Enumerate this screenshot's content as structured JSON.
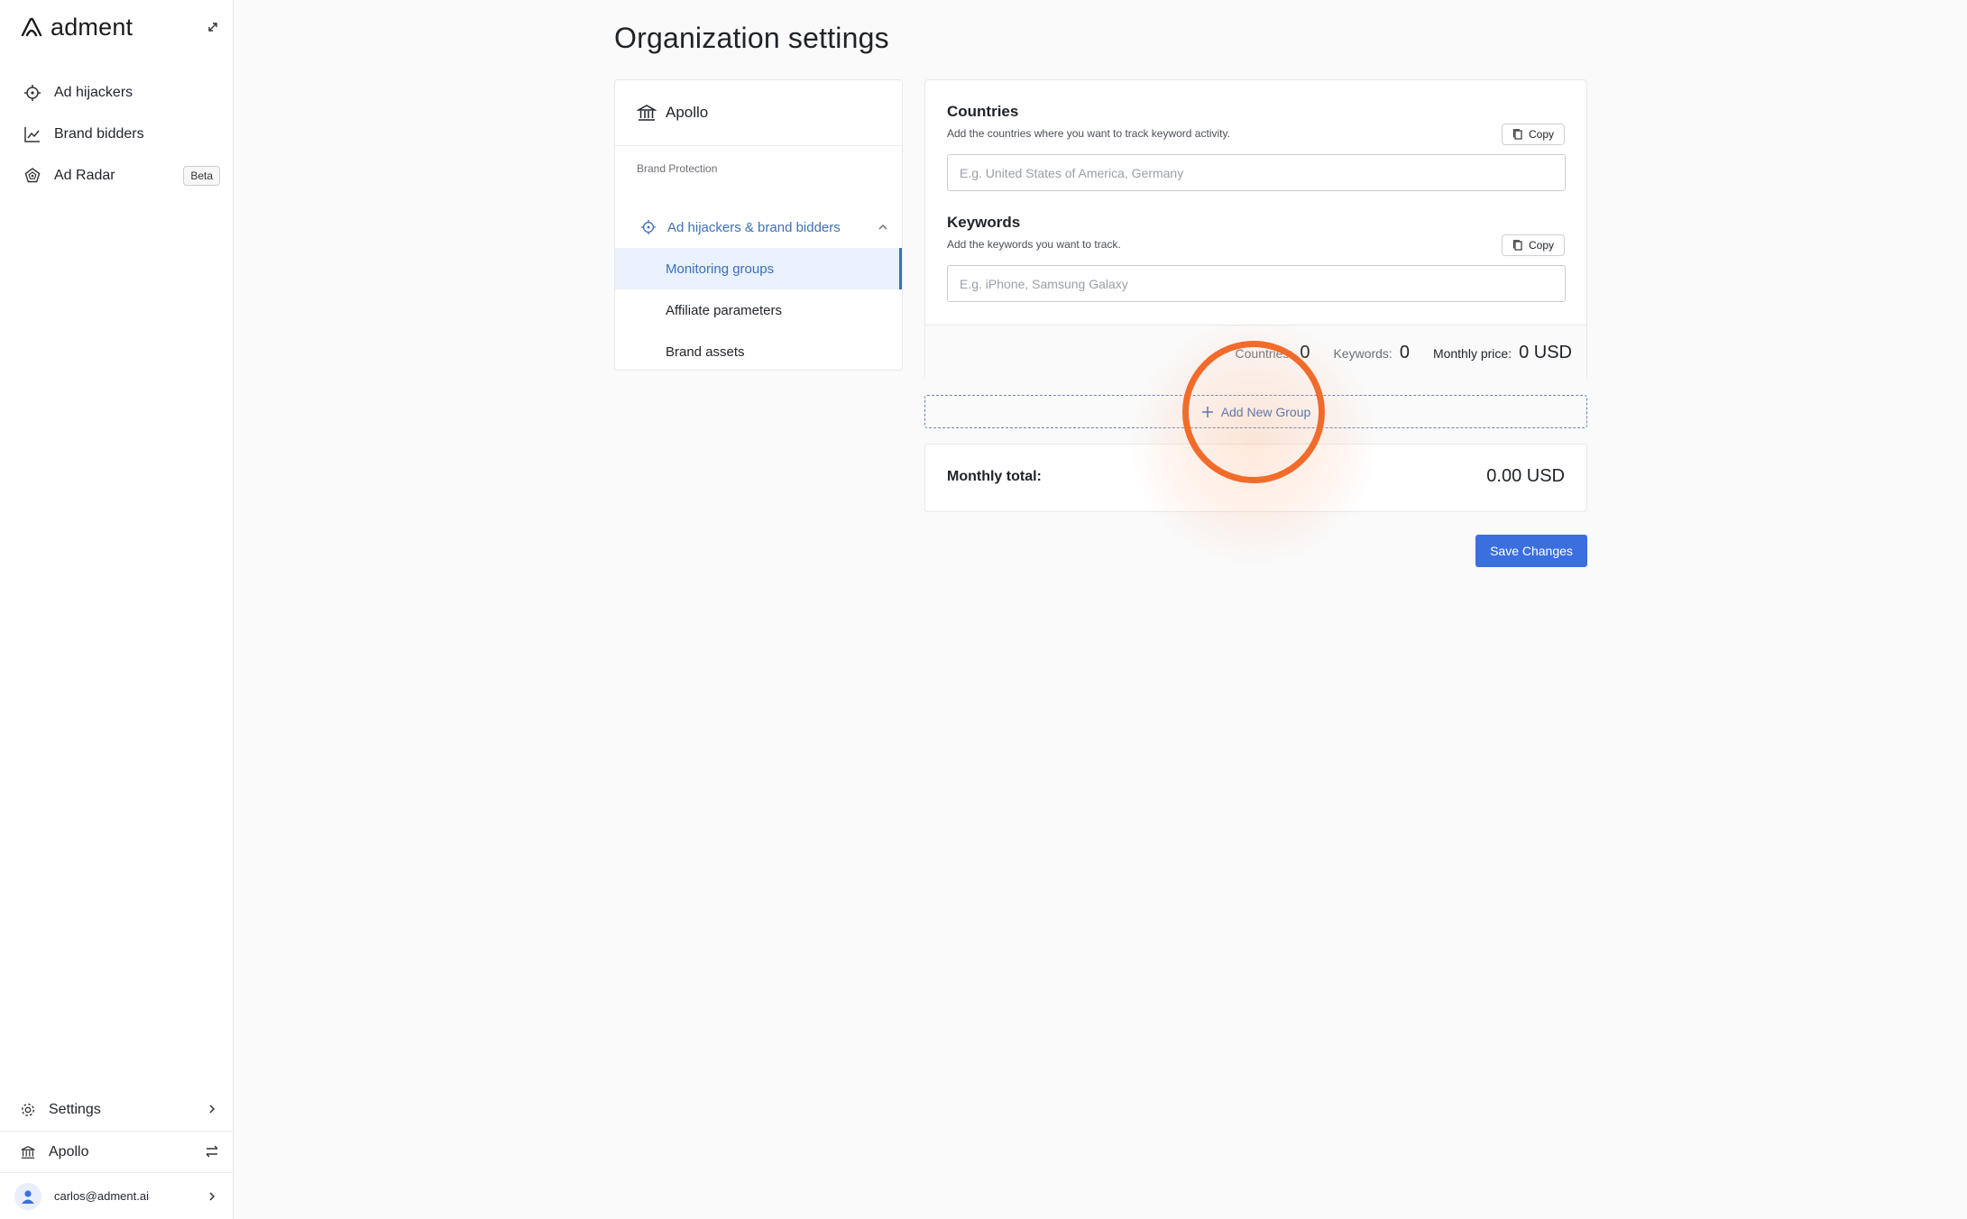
{
  "sidebar": {
    "brand": "adment",
    "nav": [
      {
        "label": "Ad hijackers",
        "icon": "crosshair-icon"
      },
      {
        "label": "Brand bidders",
        "icon": "line-chart-icon"
      },
      {
        "label": "Ad Radar",
        "icon": "radar-icon",
        "badge": "Beta"
      }
    ],
    "bottom": {
      "settings": "Settings",
      "org": "Apollo",
      "user": "carlos@adment.ai"
    }
  },
  "page": {
    "title": "Organization settings"
  },
  "org_panel": {
    "org_name": "Apollo",
    "section_label": "Brand Protection",
    "parent_item": "Ad hijackers & brand bidders",
    "sub_items": [
      "Monitoring groups",
      "Affiliate parameters",
      "Brand assets"
    ],
    "active_sub_item": "Monitoring groups"
  },
  "group_card": {
    "countries": {
      "title": "Countries",
      "description": "Add the countries where you want to track keyword activity.",
      "copy_label": "Copy",
      "placeholder": "E.g. United States of America, Germany",
      "value": ""
    },
    "keywords": {
      "title": "Keywords",
      "description": "Add the keywords you want to track.",
      "copy_label": "Copy",
      "placeholder": "E.g. iPhone, Samsung Galaxy",
      "value": ""
    },
    "footer": {
      "countries_label": "Countries:",
      "countries_value": "0",
      "keywords_label": "Keywords:",
      "keywords_value": "0",
      "price_label": "Monthly price:",
      "price_value": "0 USD"
    }
  },
  "add_group_label": "Add New Group",
  "total": {
    "label": "Monthly total:",
    "value": "0.00 USD"
  },
  "save_label": "Save Changes",
  "colors": {
    "accent": "#3f6fb5",
    "primary_button": "#3b6fe0",
    "click_indicator": "#f26b2a"
  }
}
